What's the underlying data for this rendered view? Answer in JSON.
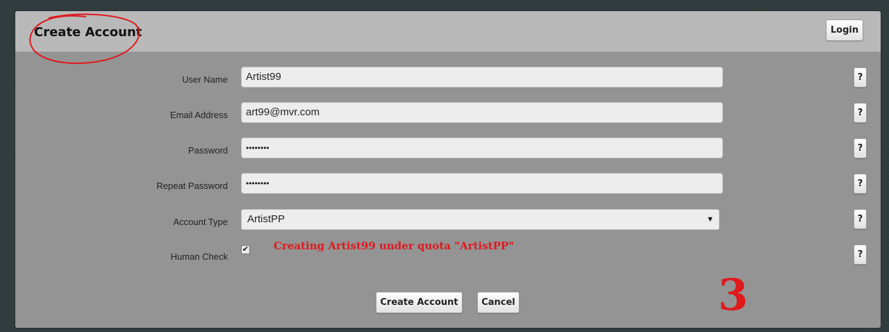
{
  "header": {
    "title": "Create Account",
    "login_label": "Login"
  },
  "form": {
    "rows": [
      {
        "label": "User Name",
        "value": "Artist99"
      },
      {
        "label": "Email Address",
        "value": "art99@mvr.com"
      },
      {
        "label": "Password",
        "value": "••••••••"
      },
      {
        "label": "Repeat Password",
        "value": "••••••••"
      },
      {
        "label": "Account Type",
        "value": "ArtistPP"
      },
      {
        "label": "Human Check",
        "value": "✔"
      }
    ],
    "help_label": "?",
    "quota_note": "Creating Artist99 under quota \"ArtistPP\"",
    "dropdown_arrow": "▼"
  },
  "actions": {
    "create_label": "Create Account",
    "cancel_label": "Cancel"
  },
  "annotation": {
    "step_number": "3",
    "color": "#e0191d"
  }
}
